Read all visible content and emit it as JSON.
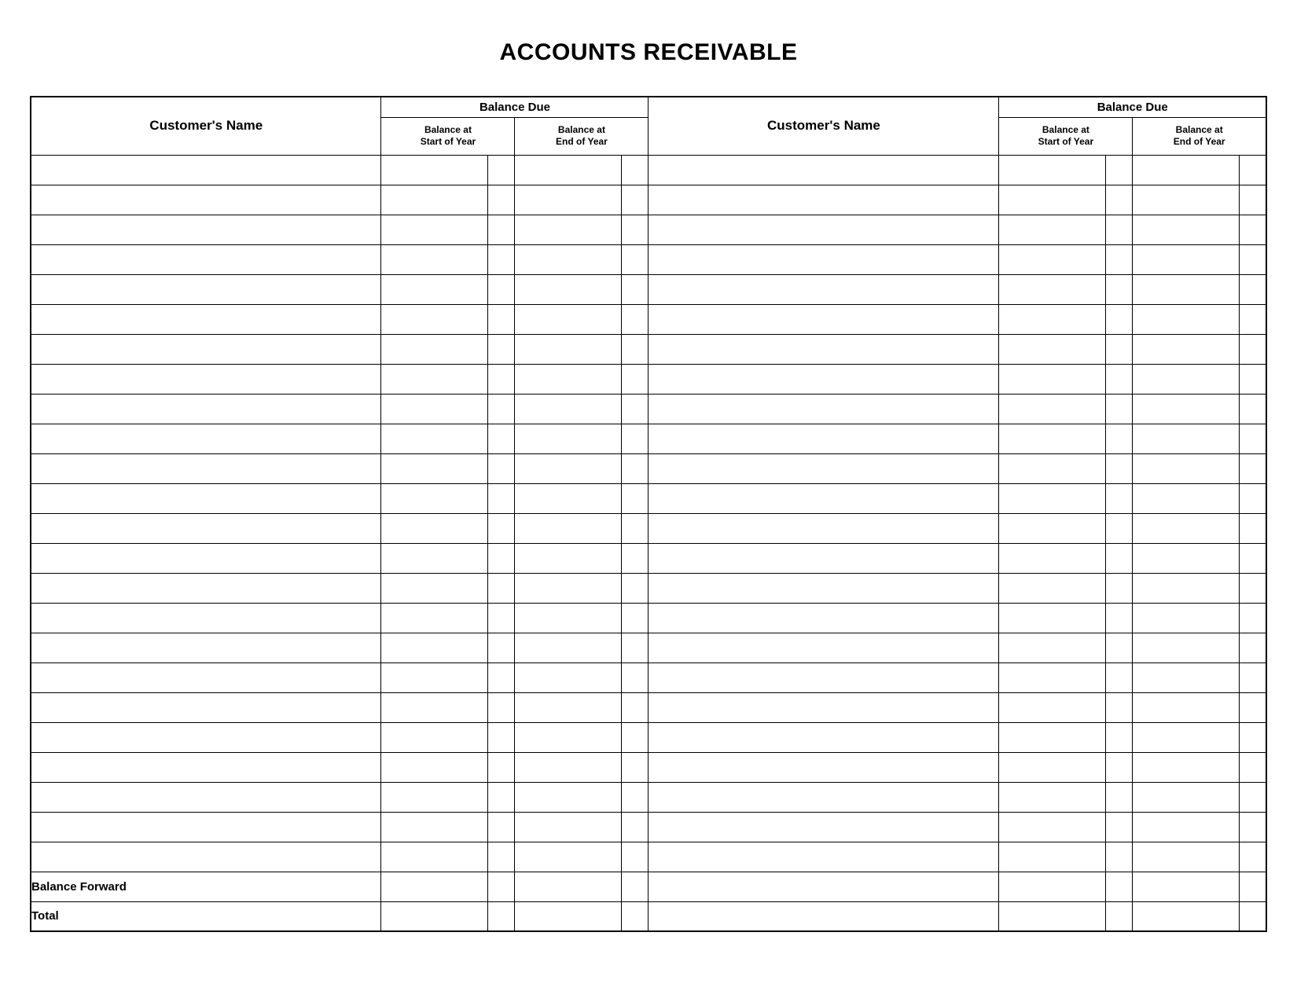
{
  "title": "ACCOUNTS RECEIVABLE",
  "headers": {
    "customer_name": "Customer's Name",
    "balance_due": "Balance Due",
    "balance_start": "Balance at\nStart of Year",
    "balance_end": "Balance at\nEnd of Year"
  },
  "footer": {
    "balance_forward": "Balance Forward",
    "total": "Total"
  },
  "blank_row_count": 24
}
